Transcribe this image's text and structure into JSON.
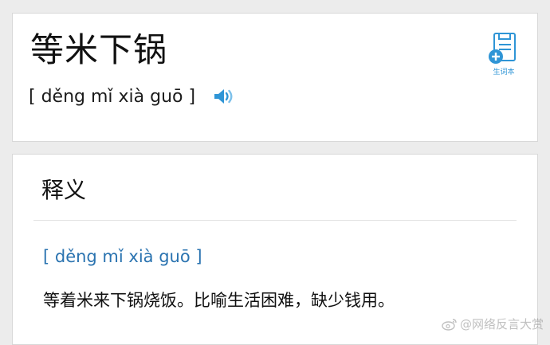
{
  "entry": {
    "word": "等米下锅",
    "pinyin": "[ děng mǐ xià guō ]",
    "speaker_icon": "speaker-icon",
    "vocab_book": {
      "icon": "notebook-add-icon",
      "label": "生词本"
    }
  },
  "definition": {
    "section_title": "释义",
    "pinyin": "[ děng mǐ xià guō ]",
    "text": "等着米来下锅烧饭。比喻生活困难，缺少钱用。"
  },
  "watermark": {
    "icon": "weibo-icon",
    "text": "@网络反言大赏"
  },
  "colors": {
    "accent": "#2f95d6",
    "pinyin_link": "#2a73b0",
    "background": "#ececec",
    "card": "#ffffff"
  }
}
